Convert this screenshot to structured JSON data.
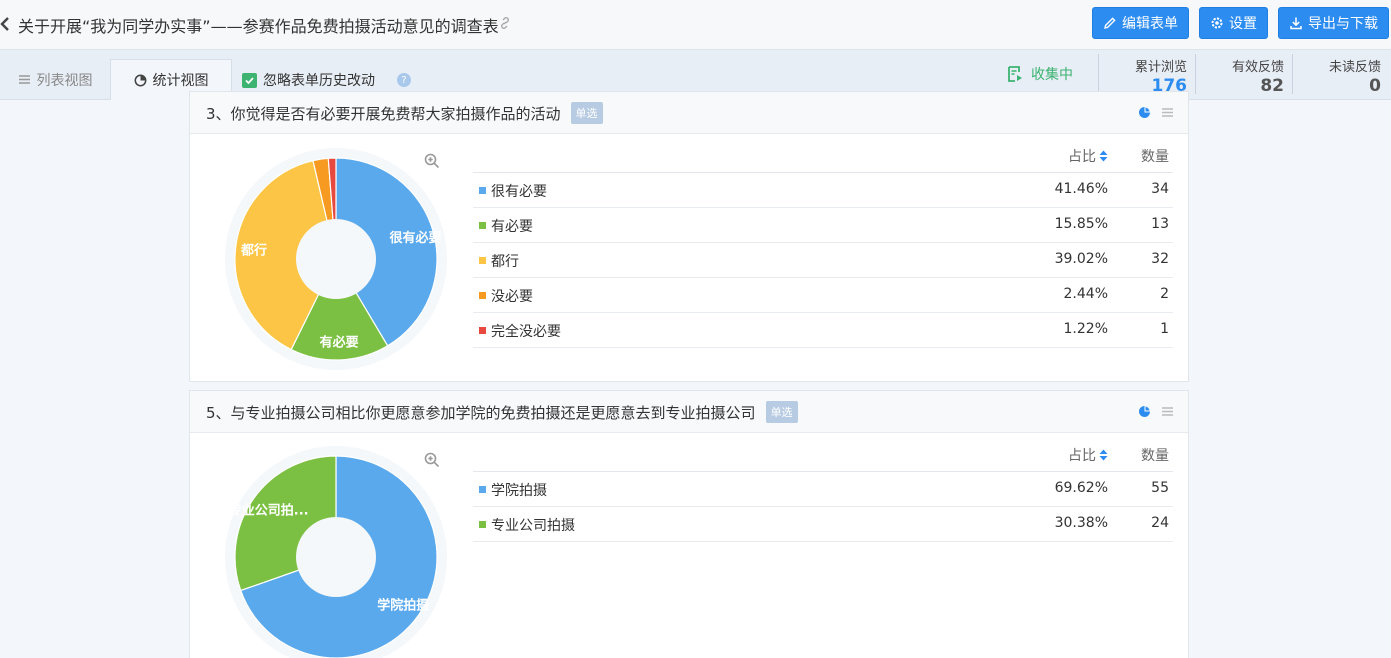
{
  "header": {
    "title": "关于开展“我为同学办实事”——参赛作品免费拍摄活动意见的调查表",
    "buttons": {
      "edit": "编辑表单",
      "settings": "设置",
      "export": "导出与下载"
    }
  },
  "toolbar": {
    "tabs": [
      {
        "label": "列表视图"
      },
      {
        "label": "统计视图"
      }
    ],
    "ignore_history_label": "忽略表单历史改动",
    "ignore_history_checked": true,
    "status": "收集中",
    "stats": [
      {
        "label": "累计浏览",
        "value": "176"
      },
      {
        "label": "有效反馈",
        "value": "82"
      },
      {
        "label": "未读反馈",
        "value": "0"
      }
    ]
  },
  "table_headers": {
    "pct": "占比",
    "count": "数量"
  },
  "questions": [
    {
      "title": "3、你觉得是否有必要开展免费帮大家拍摄作品的活动",
      "badge": "单选",
      "options": [
        {
          "label": "很有必要",
          "pct": "41.46%",
          "count": "34",
          "color": "#5aa9ec"
        },
        {
          "label": "有必要",
          "pct": "15.85%",
          "count": "13",
          "color": "#7cc043"
        },
        {
          "label": "都行",
          "pct": "39.02%",
          "count": "32",
          "color": "#fcc545"
        },
        {
          "label": "没必要",
          "pct": "2.44%",
          "count": "2",
          "color": "#f69a21"
        },
        {
          "label": "完全没必要",
          "pct": "1.22%",
          "count": "1",
          "color": "#e8493f"
        }
      ]
    },
    {
      "title": "5、与专业拍摄公司相比你更愿意参加学院的免费拍摄还是更愿意去到专业拍摄公司",
      "badge": "单选",
      "options": [
        {
          "label": "学院拍摄",
          "pct": "69.62%",
          "count": "55",
          "color": "#5aa9ec"
        },
        {
          "label": "专业公司拍摄",
          "pct": "30.38%",
          "count": "24",
          "color": "#7cc043"
        }
      ]
    }
  ],
  "chart_data": [
    {
      "type": "pie",
      "categories": [
        "很有必要",
        "有必要",
        "都行",
        "没必要",
        "完全没必要"
      ],
      "values": [
        34,
        13,
        32,
        2,
        1
      ],
      "slice_labels": [
        "很有必要",
        "有必要",
        "都行",
        "",
        ""
      ],
      "colors": [
        "#5aa9ec",
        "#7cc043",
        "#fcc545",
        "#f69a21",
        "#e8493f"
      ]
    },
    {
      "type": "pie",
      "categories": [
        "学院拍摄",
        "专业公司拍摄"
      ],
      "values": [
        55,
        24
      ],
      "slice_labels": [
        "学院拍摄",
        "专业公司拍..."
      ],
      "colors": [
        "#5aa9ec",
        "#7cc043"
      ]
    }
  ]
}
